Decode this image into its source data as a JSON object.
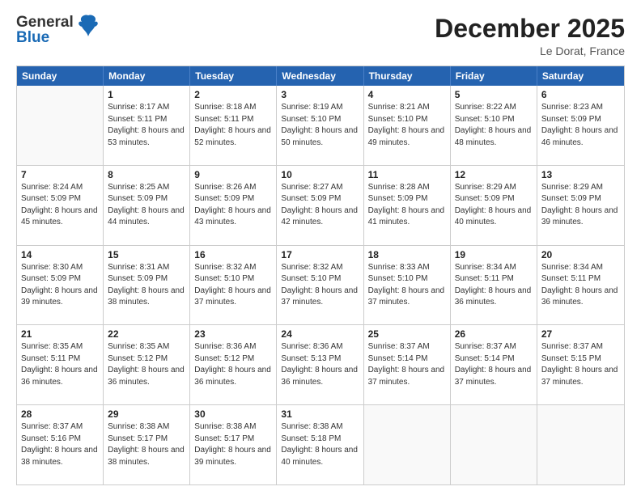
{
  "header": {
    "logo_line1": "General",
    "logo_line2": "Blue",
    "month": "December 2025",
    "location": "Le Dorat, France"
  },
  "weekdays": [
    "Sunday",
    "Monday",
    "Tuesday",
    "Wednesday",
    "Thursday",
    "Friday",
    "Saturday"
  ],
  "weeks": [
    [
      {
        "day": "",
        "empty": true
      },
      {
        "day": "1",
        "sunrise": "8:17 AM",
        "sunset": "5:11 PM",
        "daylight": "8 hours and 53 minutes."
      },
      {
        "day": "2",
        "sunrise": "8:18 AM",
        "sunset": "5:11 PM",
        "daylight": "8 hours and 52 minutes."
      },
      {
        "day": "3",
        "sunrise": "8:19 AM",
        "sunset": "5:10 PM",
        "daylight": "8 hours and 50 minutes."
      },
      {
        "day": "4",
        "sunrise": "8:21 AM",
        "sunset": "5:10 PM",
        "daylight": "8 hours and 49 minutes."
      },
      {
        "day": "5",
        "sunrise": "8:22 AM",
        "sunset": "5:10 PM",
        "daylight": "8 hours and 48 minutes."
      },
      {
        "day": "6",
        "sunrise": "8:23 AM",
        "sunset": "5:09 PM",
        "daylight": "8 hours and 46 minutes."
      }
    ],
    [
      {
        "day": "7",
        "sunrise": "8:24 AM",
        "sunset": "5:09 PM",
        "daylight": "8 hours and 45 minutes."
      },
      {
        "day": "8",
        "sunrise": "8:25 AM",
        "sunset": "5:09 PM",
        "daylight": "8 hours and 44 minutes."
      },
      {
        "day": "9",
        "sunrise": "8:26 AM",
        "sunset": "5:09 PM",
        "daylight": "8 hours and 43 minutes."
      },
      {
        "day": "10",
        "sunrise": "8:27 AM",
        "sunset": "5:09 PM",
        "daylight": "8 hours and 42 minutes."
      },
      {
        "day": "11",
        "sunrise": "8:28 AM",
        "sunset": "5:09 PM",
        "daylight": "8 hours and 41 minutes."
      },
      {
        "day": "12",
        "sunrise": "8:29 AM",
        "sunset": "5:09 PM",
        "daylight": "8 hours and 40 minutes."
      },
      {
        "day": "13",
        "sunrise": "8:29 AM",
        "sunset": "5:09 PM",
        "daylight": "8 hours and 39 minutes."
      }
    ],
    [
      {
        "day": "14",
        "sunrise": "8:30 AM",
        "sunset": "5:09 PM",
        "daylight": "8 hours and 39 minutes."
      },
      {
        "day": "15",
        "sunrise": "8:31 AM",
        "sunset": "5:09 PM",
        "daylight": "8 hours and 38 minutes."
      },
      {
        "day": "16",
        "sunrise": "8:32 AM",
        "sunset": "5:10 PM",
        "daylight": "8 hours and 37 minutes."
      },
      {
        "day": "17",
        "sunrise": "8:32 AM",
        "sunset": "5:10 PM",
        "daylight": "8 hours and 37 minutes."
      },
      {
        "day": "18",
        "sunrise": "8:33 AM",
        "sunset": "5:10 PM",
        "daylight": "8 hours and 37 minutes."
      },
      {
        "day": "19",
        "sunrise": "8:34 AM",
        "sunset": "5:11 PM",
        "daylight": "8 hours and 36 minutes."
      },
      {
        "day": "20",
        "sunrise": "8:34 AM",
        "sunset": "5:11 PM",
        "daylight": "8 hours and 36 minutes."
      }
    ],
    [
      {
        "day": "21",
        "sunrise": "8:35 AM",
        "sunset": "5:11 PM",
        "daylight": "8 hours and 36 minutes."
      },
      {
        "day": "22",
        "sunrise": "8:35 AM",
        "sunset": "5:12 PM",
        "daylight": "8 hours and 36 minutes."
      },
      {
        "day": "23",
        "sunrise": "8:36 AM",
        "sunset": "5:12 PM",
        "daylight": "8 hours and 36 minutes."
      },
      {
        "day": "24",
        "sunrise": "8:36 AM",
        "sunset": "5:13 PM",
        "daylight": "8 hours and 36 minutes."
      },
      {
        "day": "25",
        "sunrise": "8:37 AM",
        "sunset": "5:14 PM",
        "daylight": "8 hours and 37 minutes."
      },
      {
        "day": "26",
        "sunrise": "8:37 AM",
        "sunset": "5:14 PM",
        "daylight": "8 hours and 37 minutes."
      },
      {
        "day": "27",
        "sunrise": "8:37 AM",
        "sunset": "5:15 PM",
        "daylight": "8 hours and 37 minutes."
      }
    ],
    [
      {
        "day": "28",
        "sunrise": "8:37 AM",
        "sunset": "5:16 PM",
        "daylight": "8 hours and 38 minutes."
      },
      {
        "day": "29",
        "sunrise": "8:38 AM",
        "sunset": "5:17 PM",
        "daylight": "8 hours and 38 minutes."
      },
      {
        "day": "30",
        "sunrise": "8:38 AM",
        "sunset": "5:17 PM",
        "daylight": "8 hours and 39 minutes."
      },
      {
        "day": "31",
        "sunrise": "8:38 AM",
        "sunset": "5:18 PM",
        "daylight": "8 hours and 40 minutes."
      },
      {
        "day": "",
        "empty": true
      },
      {
        "day": "",
        "empty": true
      },
      {
        "day": "",
        "empty": true
      }
    ]
  ]
}
